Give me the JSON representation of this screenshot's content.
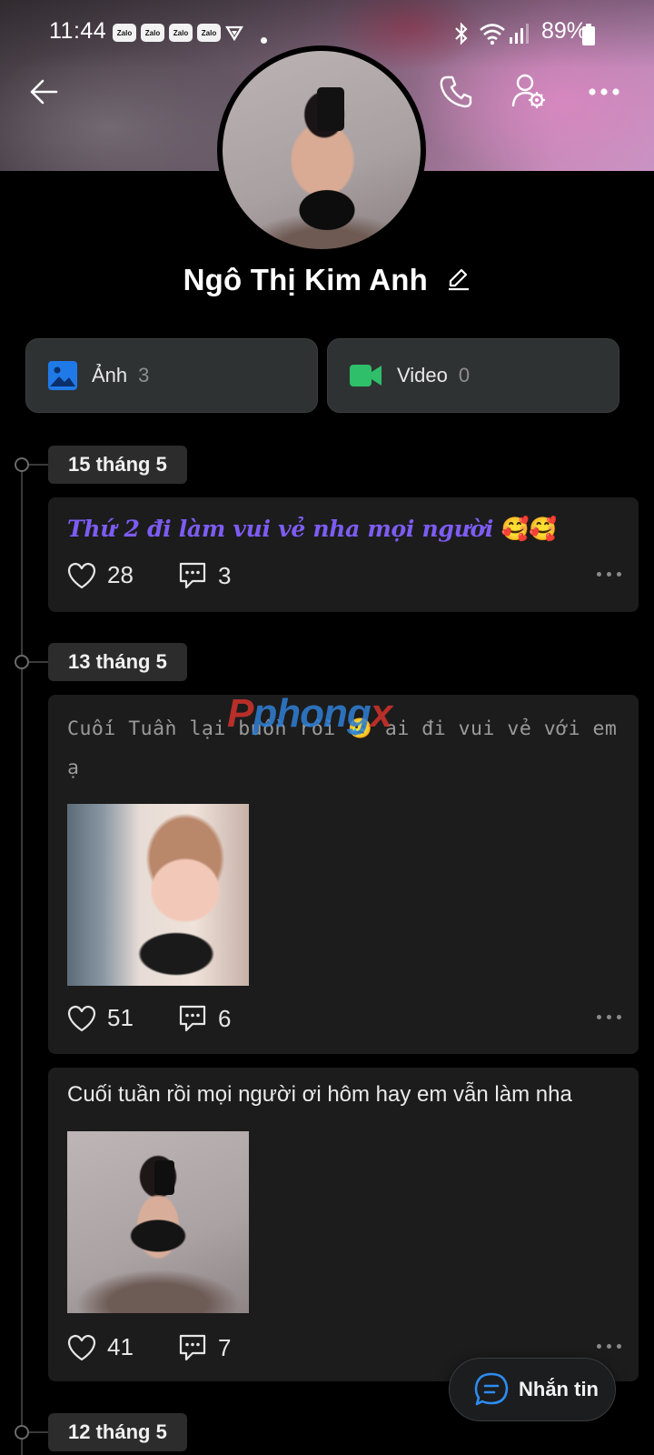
{
  "status_bar": {
    "time": "11:44",
    "notification_badges": [
      "Zalo",
      "Zalo",
      "Zalo",
      "Zalo"
    ],
    "battery": "89%"
  },
  "profile": {
    "name": "Ngô Thị Kim Anh"
  },
  "media": {
    "photos": {
      "label": "Ảnh",
      "count": "3"
    },
    "videos": {
      "label": "Video",
      "count": "0"
    }
  },
  "timeline": {
    "groups": [
      {
        "date": "15 tháng 5",
        "posts": [
          {
            "text": "Thứ 2 đi làm vui vẻ nha mọi người",
            "emoji": "🥰🥰",
            "likes": "28",
            "comments": "3"
          }
        ]
      },
      {
        "date": "13 tháng 5",
        "posts": [
          {
            "text": "Cuối Tuần lại buồn rồi 😢 ai đi vui vẻ với em ạ",
            "likes": "51",
            "comments": "6"
          },
          {
            "text": "Cuối tuần rồi mọi người ơi hôm hay em vẫn làm nha",
            "likes": "41",
            "comments": "7"
          }
        ]
      },
      {
        "date": "12 tháng 5",
        "posts": []
      }
    ]
  },
  "watermark": {
    "part1": "P",
    "part2": "phong",
    "part3": "x"
  },
  "message_button": {
    "label": "Nhắn tin"
  },
  "colors": {
    "accent_purple": "#7d5cf4",
    "photo_icon": "#1f7ae8",
    "video_icon": "#2fbf6a"
  }
}
